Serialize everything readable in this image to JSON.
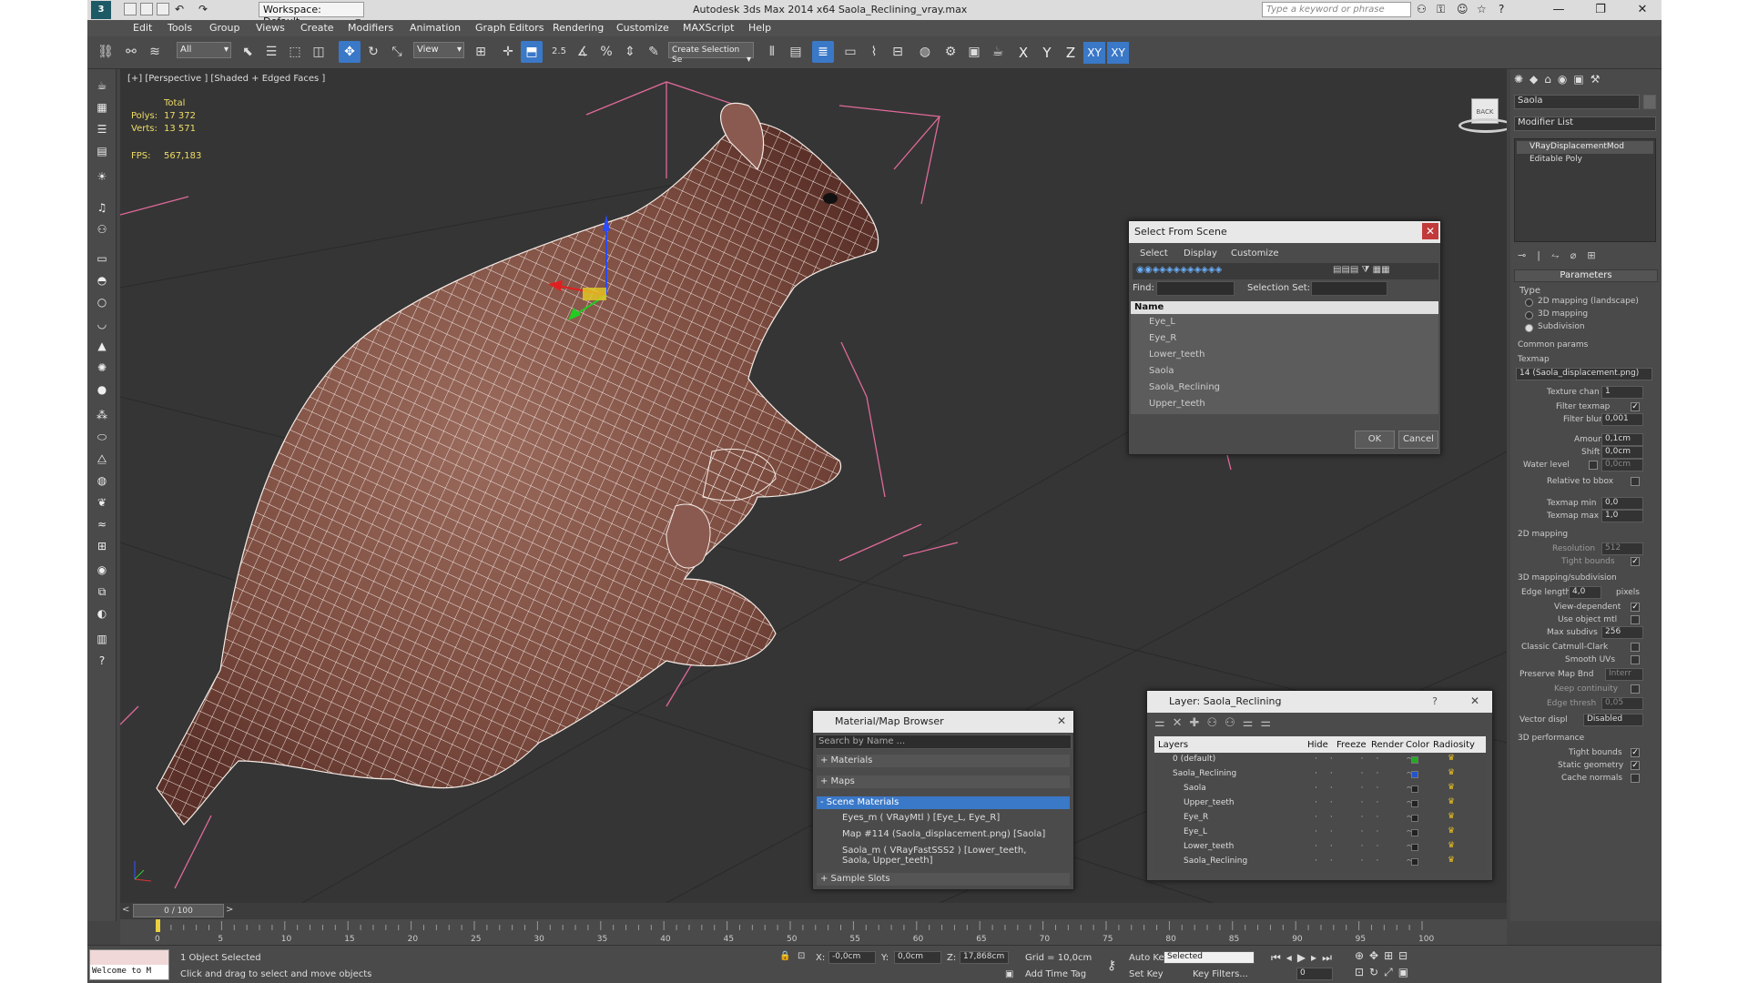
{
  "app": {
    "title": "Autodesk 3ds Max  2014 x64     Saola_Reclining_vray.max",
    "workspace": "Workspace: Default",
    "search_placeholder": "Type a keyword or phrase"
  },
  "menu": [
    "Edit",
    "Tools",
    "Group",
    "Views",
    "Create",
    "Modifiers",
    "Animation",
    "Graph Editors",
    "Rendering",
    "Customize",
    "MAXScript",
    "Help"
  ],
  "toolbar": {
    "filter": "All",
    "ref_coord": "View",
    "selection_set": "Create Selection Se",
    "snap_value": "2.5",
    "axes": [
      "X",
      "Y",
      "Z",
      "XY",
      "XY"
    ]
  },
  "viewport": {
    "label": "[+] [Perspective ] [Shaded + Edged Faces ]",
    "stats": {
      "total": "Total",
      "polys_label": "Polys:",
      "polys": "17 372",
      "verts_label": "Verts:",
      "verts": "13 571",
      "fps_label": "FPS:",
      "fps": "567,183"
    },
    "viewcube_label": "BACK"
  },
  "select_from_scene": {
    "title": "Select From Scene",
    "tabs": [
      "Select",
      "Display",
      "Customize"
    ],
    "find_label": "Find:",
    "selection_set_label": "Selection Set:",
    "column": "Name",
    "items": [
      "Eye_L",
      "Eye_R",
      "Lower_teeth",
      "Saola",
      "Saola_Reclining",
      "Upper_teeth"
    ],
    "ok": "OK",
    "cancel": "Cancel"
  },
  "material_browser": {
    "title": "Material/Map Browser",
    "search_placeholder": "Search by Name ...",
    "sections": [
      "+ Materials",
      "+ Maps",
      "- Scene Materials"
    ],
    "scene_materials": [
      "Eyes_m  ( VRayMtl )  [Eye_L, Eye_R]",
      "Map #114 (Saola_displacement.png)  [Saola]",
      "Saola_m  ( VRayFastSSS2 )  [Lower_teeth, Saola, Upper_teeth]"
    ],
    "sample_slots": "+ Sample Slots"
  },
  "layer_dialog": {
    "title": "Layer: Saola_Reclining",
    "help": "?",
    "columns": [
      "Layers",
      "Hide",
      "Freeze",
      "Render",
      "Color",
      "Radiosity"
    ],
    "rows": [
      {
        "name": "0 (default)",
        "indent": 0,
        "color": "#22aa22"
      },
      {
        "name": "Saola_Reclining",
        "indent": 0,
        "color": "#2255cc"
      },
      {
        "name": "Saola",
        "indent": 1,
        "color": "#222222"
      },
      {
        "name": "Upper_teeth",
        "indent": 1,
        "color": "#222222"
      },
      {
        "name": "Eye_R",
        "indent": 1,
        "color": "#222222"
      },
      {
        "name": "Eye_L",
        "indent": 1,
        "color": "#222222"
      },
      {
        "name": "Lower_teeth",
        "indent": 1,
        "color": "#222222"
      },
      {
        "name": "Saola_Reclining",
        "indent": 1,
        "color": "#222222"
      }
    ]
  },
  "command_panel": {
    "object_name": "Saola",
    "modifier_list": "Modifier List",
    "stack": [
      "VRayDisplacementMod",
      "Editable Poly"
    ],
    "rollout": "Parameters",
    "type_label": "Type",
    "type_options": [
      "2D mapping (landscape)",
      "3D mapping",
      "Subdivision"
    ],
    "common_params": "Common params",
    "texmap_label": "Texmap",
    "texmap": "14 (Saola_displacement.png)",
    "texture_chan_label": "Texture chan",
    "texture_chan": "1",
    "filter_texmap": "Filter texmap",
    "filter_blur_label": "Filter blur",
    "filter_blur": "0,001",
    "amount_label": "Amount",
    "amount": "0,1cm",
    "shift_label": "Shift",
    "shift": "0,0cm",
    "water_level_label": "Water level",
    "water_level": "0,0cm",
    "relative_to_bbox": "Relative to bbox",
    "texmap_min_label": "Texmap min",
    "texmap_min": "0,0",
    "texmap_max_label": "Texmap max",
    "texmap_max": "1,0",
    "mapping_2d": "2D mapping",
    "resolution_label": "Resolution",
    "resolution": "512",
    "tight_bounds": "Tight bounds",
    "mapping_3d": "3D mapping/subdivision",
    "edge_length_label": "Edge length",
    "edge_length": "4,0",
    "pixels": "pixels",
    "view_dependent": "View-dependent",
    "use_object_mtl": "Use object mtl",
    "max_subdivs_label": "Max subdivs",
    "max_subdivs": "256",
    "classic_catmull": "Classic Catmull-Clark",
    "smooth_uvs": "Smooth UVs",
    "preserve_map_bnd_label": "Preserve Map Bnd",
    "preserve_map_bnd": "Interr",
    "keep_continuity": "Keep continuity",
    "edge_thresh_label": "Edge thresh",
    "edge_thresh": "0,05",
    "vector_displ_label": "Vector displ",
    "vector_displ": "Disabled",
    "performance": "3D performance",
    "tight_bounds2": "Tight bounds",
    "static_geometry": "Static geometry",
    "cache_normals": "Cache normals"
  },
  "timeline": {
    "frame": "0 / 100",
    "ticks": [
      "0",
      "5",
      "10",
      "15",
      "20",
      "25",
      "30",
      "35",
      "40",
      "45",
      "50",
      "55",
      "60",
      "65",
      "70",
      "75",
      "80",
      "85",
      "90",
      "95",
      "100"
    ]
  },
  "status": {
    "maxscript": "Welcome to M",
    "selected": "1 Object Selected",
    "prompt": "Click and drag to select and move objects",
    "x_label": "X:",
    "x": "-0,0cm",
    "y_label": "Y:",
    "y": "0,0cm",
    "z_label": "Z:",
    "z": "17,868cm",
    "grid": "Grid = 10,0cm",
    "add_time_tag": "Add Time Tag",
    "auto_key": "Auto Key",
    "set_key": "Set Key",
    "key_mode": "Selected",
    "key_filters": "Key Filters...",
    "current_frame": "0"
  }
}
